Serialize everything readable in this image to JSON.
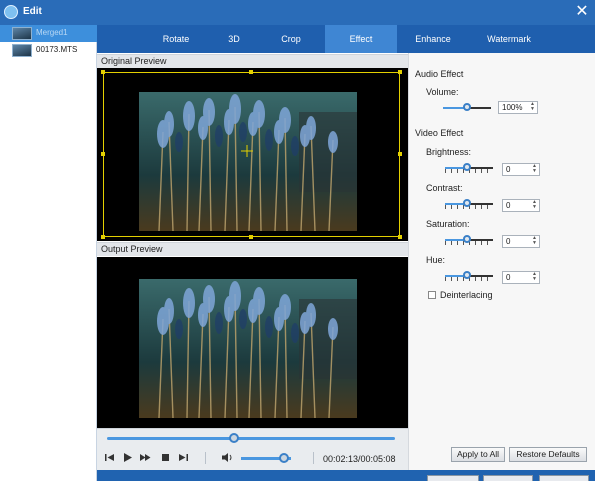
{
  "window": {
    "title": "Edit",
    "close_label": "✕"
  },
  "file_list": [
    {
      "name": "Merged1",
      "selected": true
    },
    {
      "name": "00173.MTS",
      "selected": false
    }
  ],
  "tabs": [
    {
      "label": "Rotate"
    },
    {
      "label": "3D"
    },
    {
      "label": "Crop"
    },
    {
      "label": "Effect",
      "active": true
    },
    {
      "label": "Enhance"
    },
    {
      "label": "Watermark"
    }
  ],
  "preview": {
    "original_label": "Original Preview",
    "output_label": "Output Preview"
  },
  "player": {
    "seek_fraction": 0.44,
    "volume_fraction": 0.85,
    "timecode": "00:02:13/00:05:08"
  },
  "audio_effect": {
    "heading": "Audio Effect",
    "volume_label": "Volume:",
    "volume_value": "100%"
  },
  "video_effect": {
    "heading": "Video Effect",
    "brightness_label": "Brightness:",
    "brightness_value": "0",
    "contrast_label": "Contrast:",
    "contrast_value": "0",
    "saturation_label": "Saturation:",
    "saturation_value": "0",
    "hue_label": "Hue:",
    "hue_value": "0",
    "deinterlacing_label": "Deinterlacing",
    "deinterlacing_checked": false
  },
  "buttons": {
    "apply_to_all": "Apply to All",
    "restore_defaults": "Restore Defaults"
  },
  "colors": {
    "titlebar": "#2a6cb8",
    "tab_active": "#3f86d3",
    "accent": "#4a97e0",
    "crop_frame": "#e3d000"
  },
  "icons": [
    "app-icon",
    "close-icon",
    "skip-start-icon",
    "play-icon",
    "fast-forward-icon",
    "stop-icon",
    "skip-end-icon",
    "volume-icon",
    "crosshair-icon"
  ]
}
